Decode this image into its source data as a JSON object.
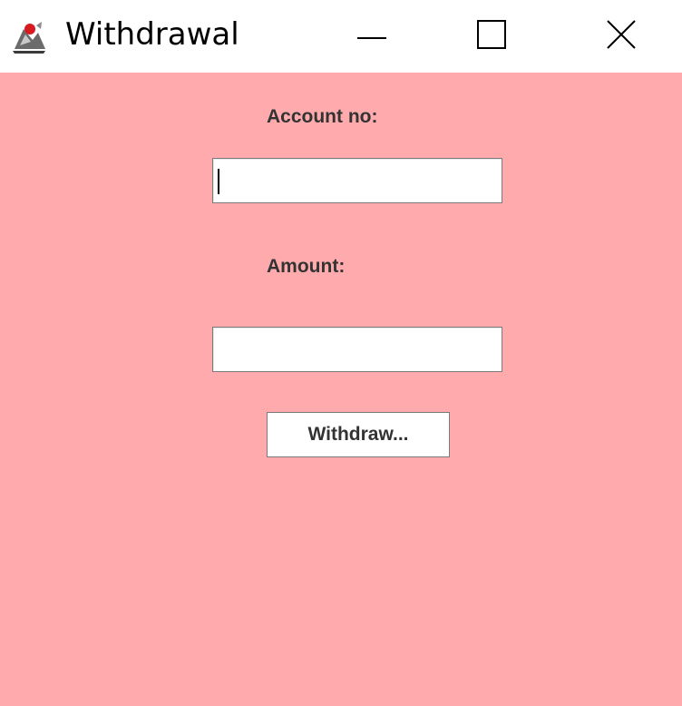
{
  "window": {
    "title": "Withdrawal",
    "app_icon": "java-duke-icon",
    "controls": {
      "minimize_icon": "minimize-icon",
      "maximize_icon": "maximize-icon",
      "close_icon": "close-icon"
    },
    "background_color": "#FFABAD"
  },
  "form": {
    "account_label": "Account no:",
    "account_value": "",
    "amount_label": "Amount:",
    "amount_value": "",
    "withdraw_button_label": "Withdraw..."
  }
}
